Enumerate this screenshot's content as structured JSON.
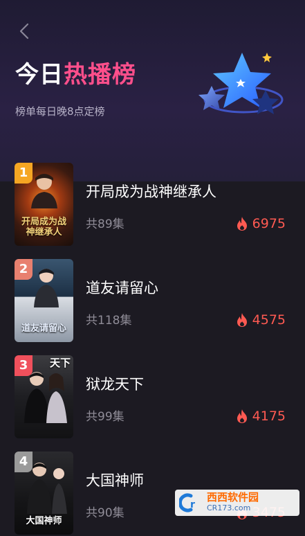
{
  "header": {
    "title_main": "今日",
    "title_highlight": "热播榜",
    "subtitle": "榜单每日晚8点定榜"
  },
  "colors": {
    "accent": "#ff4f8b",
    "heat": "#ff5a52",
    "rank1": "#f5a623",
    "rank2": "#e8806f",
    "rank3": "#f0505c",
    "rank4": "#9a9a9a"
  },
  "rankings": [
    {
      "rank": "1",
      "title": "开局成为战神继承人",
      "episodes": "共89集",
      "heat": "6975",
      "poster_text": "开局成为战神继承人"
    },
    {
      "rank": "2",
      "title": "道友请留心",
      "episodes": "共118集",
      "heat": "4575",
      "poster_text": "道友请留心"
    },
    {
      "rank": "3",
      "title": "狱龙天下",
      "episodes": "共99集",
      "heat": "4175",
      "poster_text": "天下"
    },
    {
      "rank": "4",
      "title": "大国神师",
      "episodes": "共90集",
      "heat": "3475",
      "poster_text": "大国神师"
    }
  ],
  "watermark": {
    "brand": "西西软件园",
    "url": "CR173.com"
  }
}
